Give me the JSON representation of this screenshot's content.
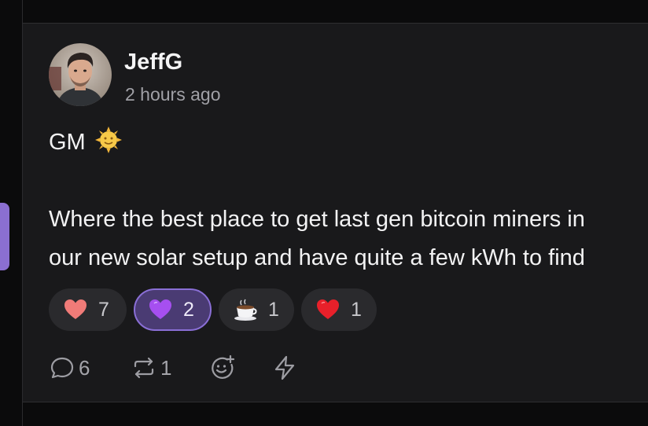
{
  "post": {
    "author": "JeffG",
    "timestamp": "2 hours ago",
    "body_line1_text": "GM",
    "body_line1_emoji": "sun-face-emoji",
    "body_line2": "Where the best place to get last gen bitcoin miners in",
    "body_line3": "our new solar setup and have quite a few kWh to find"
  },
  "reactions": [
    {
      "icon": "red-heart-icon",
      "count": "7",
      "selected": false
    },
    {
      "icon": "purple-heart-icon",
      "count": "2",
      "selected": true
    },
    {
      "icon": "hot-beverage-icon",
      "count": "1",
      "selected": false
    },
    {
      "icon": "bright-red-heart-icon",
      "count": "1",
      "selected": false
    }
  ],
  "actions": {
    "reply_count": "6",
    "repost_count": "1",
    "react_icon": "add-reaction-icon",
    "zap_icon": "lightning-icon"
  },
  "colors": {
    "card_background": "#19191b",
    "page_background": "#0b0b0c",
    "accent_purple": "#8a6fd6",
    "selected_pill": "#4a3b73",
    "muted_text": "#a0a0a6"
  }
}
